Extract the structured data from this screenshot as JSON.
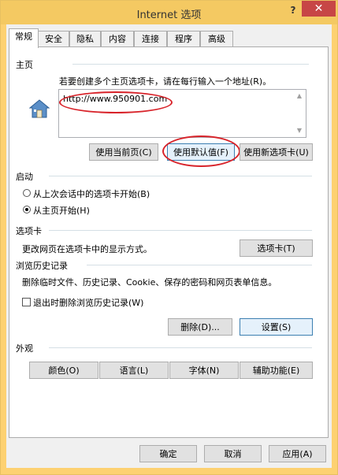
{
  "window": {
    "title": "Internet 选项",
    "help": "?",
    "close": "✕"
  },
  "tabs": [
    {
      "label": "常规"
    },
    {
      "label": "安全"
    },
    {
      "label": "隐私"
    },
    {
      "label": "内容"
    },
    {
      "label": "连接"
    },
    {
      "label": "程序"
    },
    {
      "label": "高级"
    }
  ],
  "home": {
    "group_title": "主页",
    "instruction": "若要创建多个主页选项卡，请在每行输入一个地址(R)。",
    "url": "http://www.950901.com",
    "btn_current": "使用当前页(C)",
    "btn_default": "使用默认值(F)",
    "btn_newtab": "使用新选项卡(U)"
  },
  "startup": {
    "group_title": "启动",
    "option_last": "从上次会话中的选项卡开始(B)",
    "option_home": "从主页开始(H)",
    "selected": "option_home"
  },
  "tabs_section": {
    "group_title": "选项卡",
    "description": "更改网页在选项卡中的显示方式。",
    "btn": "选项卡(T)"
  },
  "history": {
    "group_title": "浏览历史记录",
    "description": "删除临时文件、历史记录、Cookie、保存的密码和网页表单信息。",
    "checkbox_label": "退出时删除浏览历史记录(W)",
    "checkbox_checked": false,
    "btn_delete": "删除(D)...",
    "btn_settings": "设置(S)"
  },
  "appearance": {
    "group_title": "外观",
    "btn_colors": "颜色(O)",
    "btn_languages": "语言(L)",
    "btn_fonts": "字体(N)",
    "btn_accessibility": "辅助功能(E)"
  },
  "footer": {
    "ok": "确定",
    "cancel": "取消",
    "apply": "应用(A)"
  },
  "annotation_color": "#d8232a"
}
